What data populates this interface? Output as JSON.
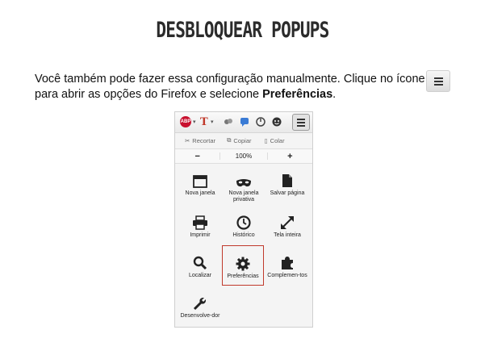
{
  "title": "DESBLOQUEAR POPUPS",
  "paragraph": {
    "line1": "Você também pode fazer essa configuração manualmente. Clique no ícone",
    "line2_prefix": "para abrir as opções do Firefox e selecione ",
    "line2_bold": "Preferências",
    "line2_suffix": "."
  },
  "panel": {
    "toolbar": {
      "abp_text": "ABP",
      "t_glyph": "T"
    },
    "edit": {
      "cut": "Recortar",
      "copy": "Copiar",
      "paste": "Colar"
    },
    "zoom": {
      "minus": "−",
      "value": "100%",
      "plus": "+"
    },
    "items": [
      {
        "label": "Nova janela",
        "icon": "window-icon"
      },
      {
        "label": "Nova janela privativa",
        "icon": "mask-icon"
      },
      {
        "label": "Salvar página",
        "icon": "page-icon"
      },
      {
        "label": "Imprimir",
        "icon": "printer-icon"
      },
      {
        "label": "Histórico",
        "icon": "clock-icon"
      },
      {
        "label": "Tela inteira",
        "icon": "fullscreen-icon"
      },
      {
        "label": "Localizar",
        "icon": "magnifier-icon"
      },
      {
        "label": "Preferências",
        "icon": "gear-icon"
      },
      {
        "label": "Complemen-tos",
        "icon": "puzzle-icon"
      },
      {
        "label": "Desenvolve-dor",
        "icon": "wrench-icon"
      }
    ]
  },
  "colors": {
    "highlight": "#c0392b",
    "abp": "#c8102e"
  }
}
